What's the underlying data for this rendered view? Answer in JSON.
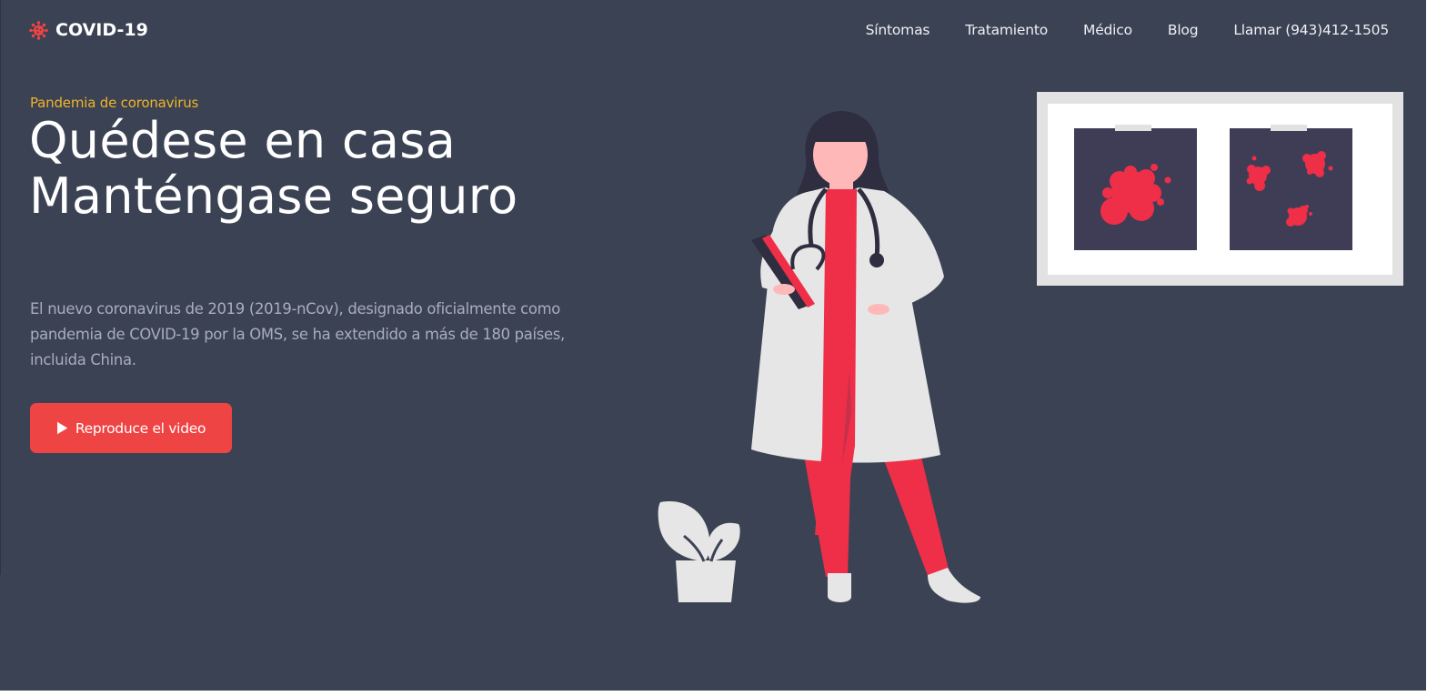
{
  "colors": {
    "background": "#3b4254",
    "accent": "#ef4444",
    "eyebrow": "#f0b429",
    "illustration_red": "#ef2e48",
    "illustration_light": "#e6e6e6"
  },
  "navbar": {
    "brand": {
      "icon": "virus-icon",
      "label": "COVID-19"
    },
    "links": [
      {
        "label": "Síntomas"
      },
      {
        "label": "Tratamiento"
      },
      {
        "label": "Médico"
      },
      {
        "label": "Blog"
      },
      {
        "label": "Llamar (943)412-1505"
      }
    ]
  },
  "hero": {
    "eyebrow": "Pandemia de coronavirus",
    "headline_line1": "Quédese en casa",
    "headline_line2": "Manténgase seguro",
    "description": "El nuevo coronavirus de 2019 (2019-nCov), designado oficialmente como pandemia de COVID-19 por la OMS, se ha extendido a más de 180 países, incluida China.",
    "cta": {
      "icon": "play-icon",
      "label": "Reproduce el video"
    }
  },
  "illustrations": {
    "doctor": "doctor-illustration",
    "plant": "potted-plant-illustration",
    "xray_board": "xray-board-illustration"
  }
}
